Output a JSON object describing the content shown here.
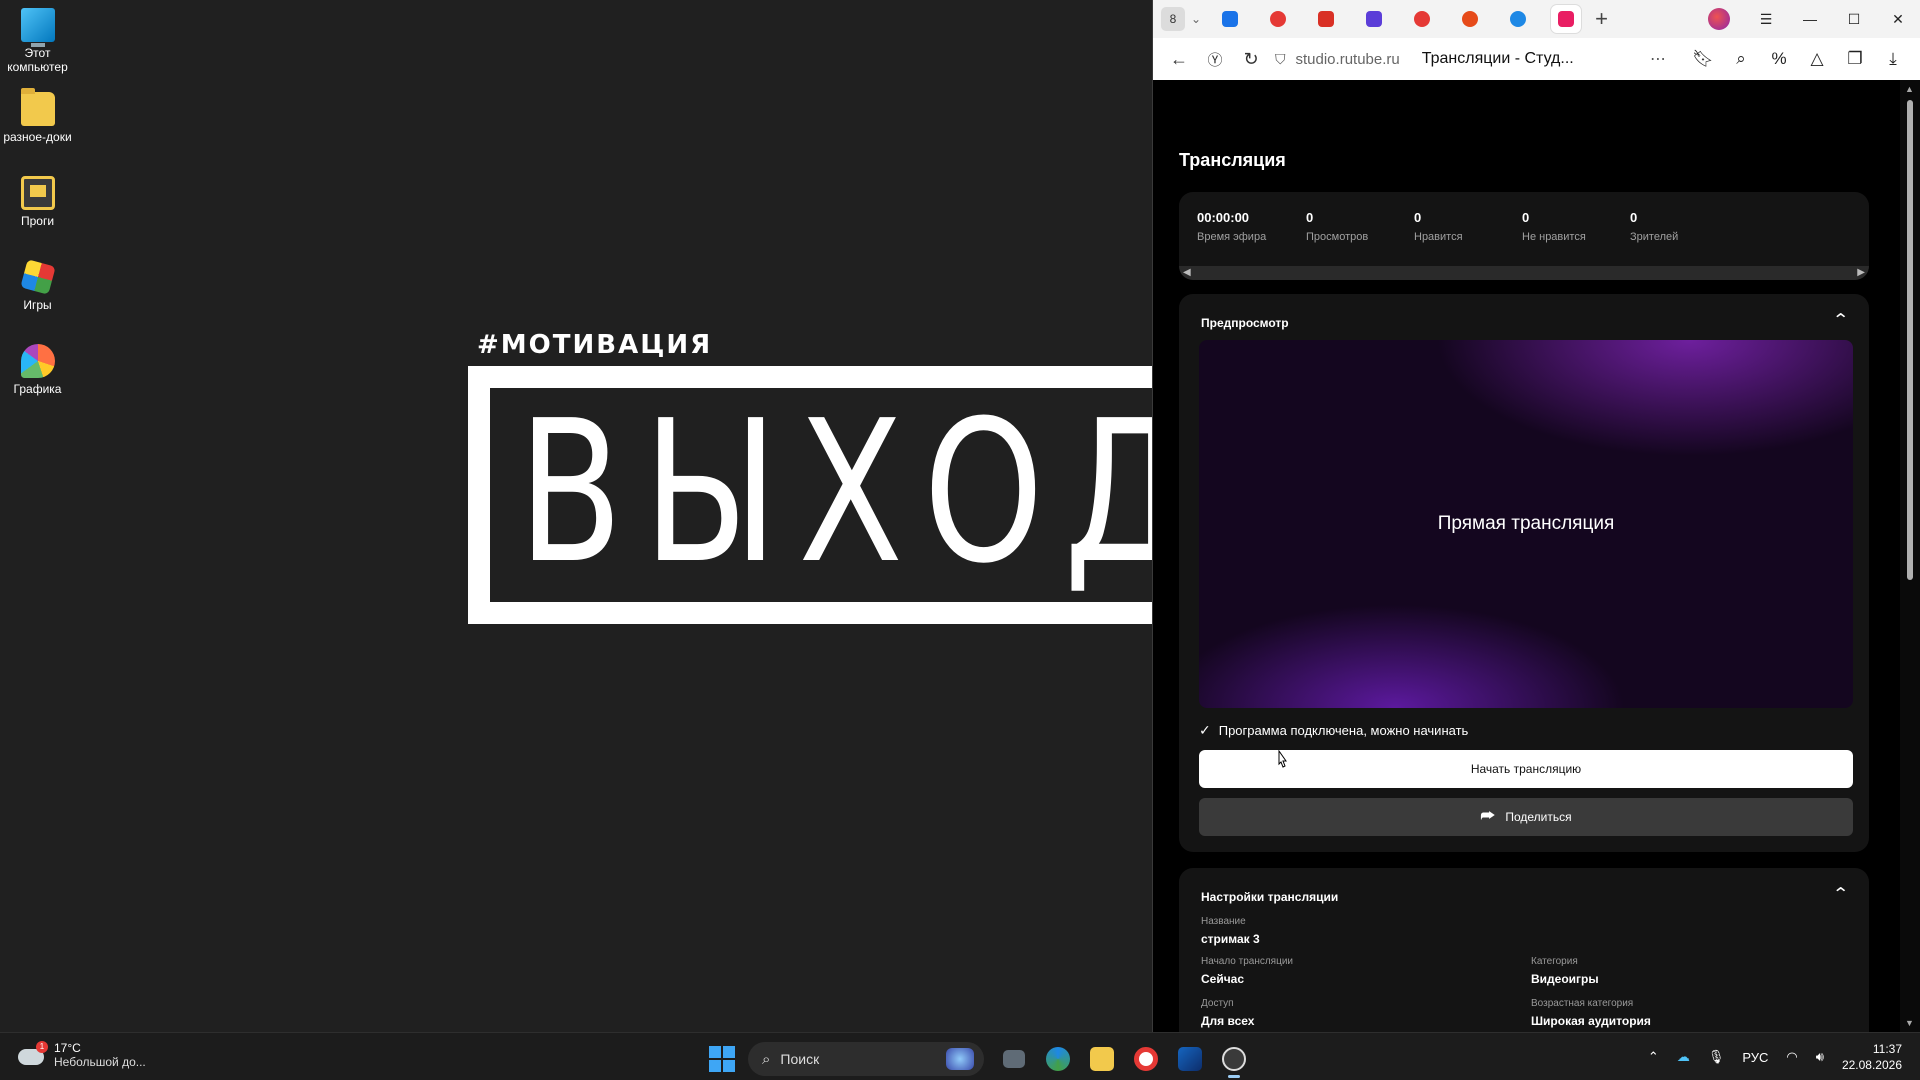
{
  "desktop": {
    "icons": [
      {
        "label": "Этот компьютер",
        "icon": "this-pc-icon"
      },
      {
        "label": "разное-доки",
        "icon": "folder-icon"
      },
      {
        "label": "Проги",
        "icon": "programs-folder-icon"
      },
      {
        "label": "Игры",
        "icon": "games-folder-icon"
      },
      {
        "label": "Графика",
        "icon": "graphics-folder-icon"
      }
    ],
    "poster": {
      "tag": "#МОТИВАЦИЯ",
      "word": "ВЫХОДИ"
    }
  },
  "browser": {
    "tab_count": "8",
    "tabs": [
      {
        "icon": "messenger-tab-icon",
        "color": "#1a73e8"
      },
      {
        "icon": "yandex-tab-icon",
        "color": "#e53935"
      },
      {
        "icon": "gmail-tab-icon",
        "color": "#d93025"
      },
      {
        "icon": "app-tab-icon",
        "color": "#5b3dd8"
      },
      {
        "icon": "yandex-tab-icon",
        "color": "#e53935"
      },
      {
        "icon": "media-tab-icon",
        "color": "#e64a19"
      },
      {
        "icon": "edge-tab-icon",
        "color": "#1e88e5"
      },
      {
        "icon": "rutube-tab-icon",
        "color": "#e91e63",
        "active": true
      }
    ],
    "new_tab": "+",
    "address": {
      "host": "studio.rutube.ru",
      "title": "Трансляции - Студ..."
    }
  },
  "page": {
    "title": "Трансляция",
    "stats": [
      {
        "value": "00:00:00",
        "label": "Время эфира"
      },
      {
        "value": "0",
        "label": "Просмотров"
      },
      {
        "value": "0",
        "label": "Нравится"
      },
      {
        "value": "0",
        "label": "Не нравится"
      },
      {
        "value": "0",
        "label": "Зрителей"
      }
    ],
    "preview": {
      "heading": "Предпросмотр",
      "video_label": "Прямая трансляция",
      "status": "Программа подключена, можно начинать",
      "start_button": "Начать трансляцию",
      "share_button": "Поделиться"
    },
    "settings": {
      "heading": "Настройки трансляции",
      "name_label": "Название",
      "name_value": "стримак 3",
      "start_label": "Начало трансляции",
      "start_value": "Сейчас",
      "category_label": "Категория",
      "category_value": "Видеоигры",
      "access_label": "Доступ",
      "access_value": "Для всех",
      "age_label": "Возрастная категория",
      "age_value": "Широкая аудитория"
    }
  },
  "taskbar": {
    "weather_temp": "17°C",
    "weather_desc": "Небольшой до...",
    "weather_badge": "1",
    "search_label": "Поиск",
    "language": "РУС",
    "time": "11:37",
    "date": "22.08.2026"
  }
}
